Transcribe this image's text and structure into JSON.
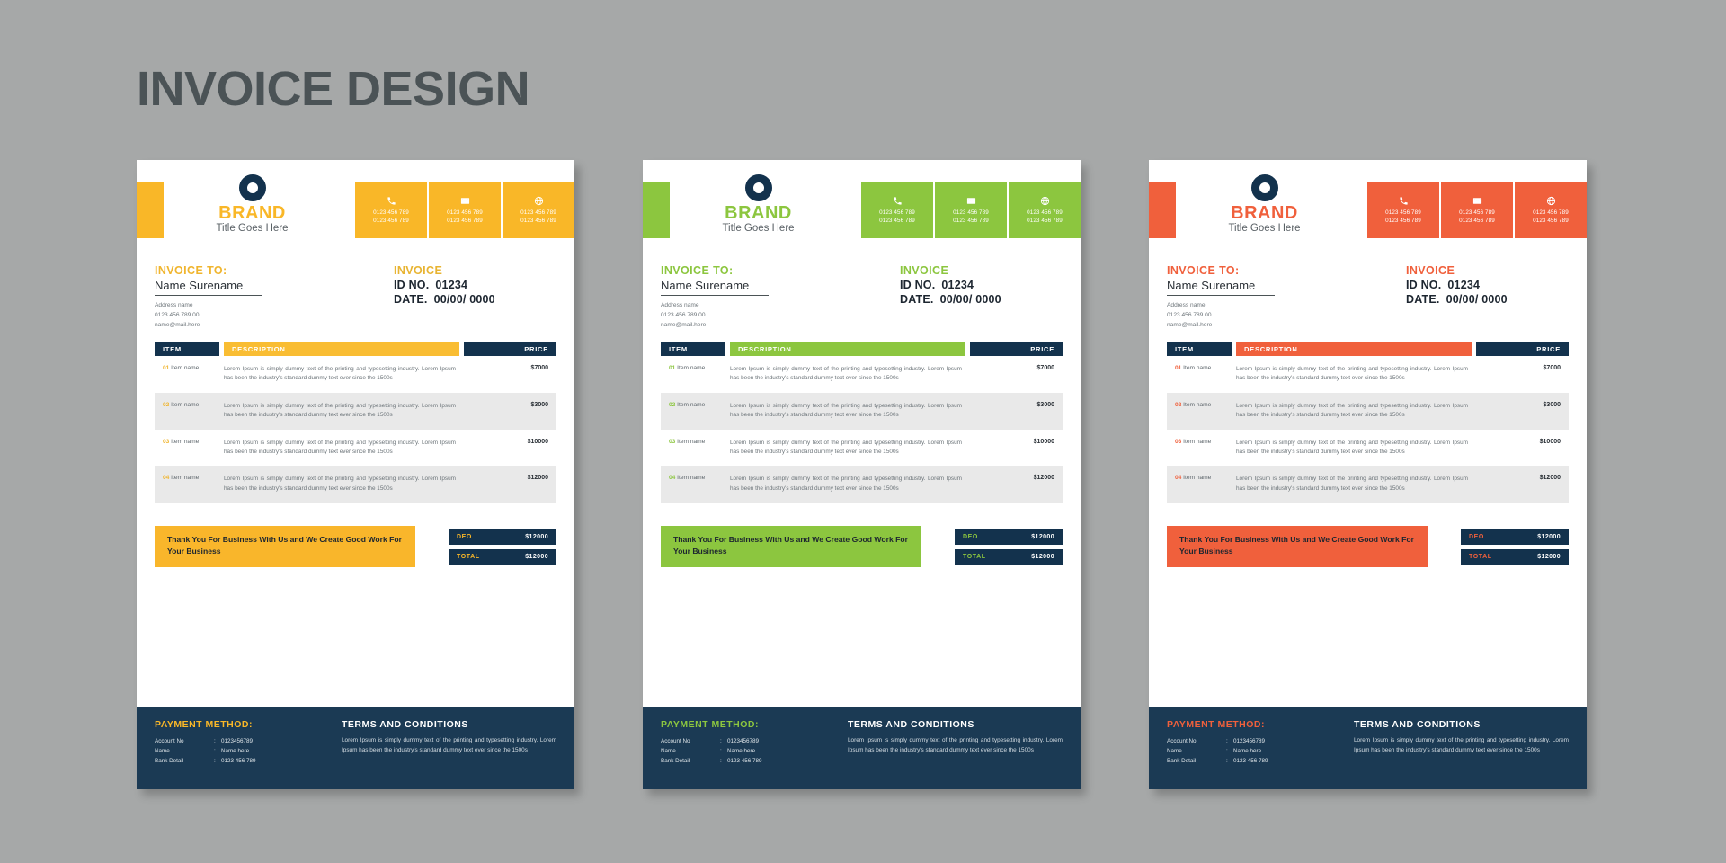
{
  "page": {
    "title": "INVOICE DESIGN",
    "background_color": "#a6a8a8",
    "title_color": "#4b5356"
  },
  "shared": {
    "brand": {
      "name": "BRAND",
      "tagline": "Title Goes Here",
      "logo_icon": "ring-circle-logo"
    },
    "contacts": [
      {
        "icon": "phone-icon",
        "line1": "0123 456 789",
        "line2": "0123 456 789"
      },
      {
        "icon": "mail-icon",
        "line1": "0123 456 789",
        "line2": "0123 456 789"
      },
      {
        "icon": "globe-icon",
        "line1": "0123 456 789",
        "line2": "0123 456 789"
      }
    ],
    "bill_to": {
      "label": "INVOICE TO:",
      "name": "Name Surename",
      "address": "Address name",
      "phone": "0123 456 789 00",
      "email": "name@mail.here"
    },
    "invoice_meta": {
      "word": "INVOICE",
      "id_label": "ID NO.",
      "id_value": "01234",
      "date_label": "DATE.",
      "date_value": "00/00/ 0000"
    },
    "table": {
      "headers": {
        "item": "ITEM",
        "description": "DESCRIPTION",
        "price": "PRICE"
      },
      "description_text": "Lorem Ipsum is simply dummy text of the printing and typesetting industry. Lorem Ipsum has been the industry's standard dummy text ever since the 1500s",
      "rows": [
        {
          "num": "01",
          "name": "Item name",
          "price": "$7000"
        },
        {
          "num": "02",
          "name": "Item name",
          "price": "$3000"
        },
        {
          "num": "03",
          "name": "Item name",
          "price": "$10000"
        },
        {
          "num": "04",
          "name": "Item name",
          "price": "$12000"
        }
      ]
    },
    "thanks": "Thank You For Business With Us and We Create Good Work For Your Business",
    "totals": [
      {
        "label": "DEO",
        "value": "$12000"
      },
      {
        "label": "TOTAL",
        "value": "$12000"
      }
    ],
    "footer": {
      "payment_heading": "PAYMENT METHOD:",
      "terms_heading": "TERMS AND CONDITIONS",
      "payment_rows": [
        {
          "key": "Account No",
          "value": "0123456789"
        },
        {
          "key": "Name",
          "value": "Name here"
        },
        {
          "key": "Bank Detail",
          "value": "0123 456 789"
        }
      ],
      "terms_text": "Lorem Ipsum is simply dummy text of the printing and typesetting industry. Lorem Ipsum has been the industry's standard dummy text ever since the 1500s",
      "background_color": "#1b3a54"
    }
  },
  "variants": [
    {
      "id": "yellow",
      "accent": "#f9b728",
      "accent_soft": "#f7b82e",
      "desc_header": "#f9bd33",
      "dark": "#13324d",
      "bill_label_color": "#f0b52e",
      "invoice_word_color": "#e8b432",
      "foot_head_color": "#f9b728",
      "thanks_bg": "#f9b62b",
      "item_num_color": "#f0b52e"
    },
    {
      "id": "green",
      "accent": "#8cc63f",
      "accent_soft": "#8dc63f",
      "desc_header": "#8cc63f",
      "dark": "#13324d",
      "bill_label_color": "#8cc63f",
      "invoice_word_color": "#8cc63f",
      "foot_head_color": "#8cc63f",
      "thanks_bg": "#8cc63f",
      "item_num_color": "#8cc63f"
    },
    {
      "id": "orange",
      "accent": "#f0603c",
      "accent_soft": "#f0603c",
      "desc_header": "#f0603c",
      "dark": "#13324d",
      "bill_label_color": "#f0603c",
      "invoice_word_color": "#f0603c",
      "foot_head_color": "#f0603c",
      "thanks_bg": "#f0603c",
      "item_num_color": "#f0603c"
    }
  ]
}
